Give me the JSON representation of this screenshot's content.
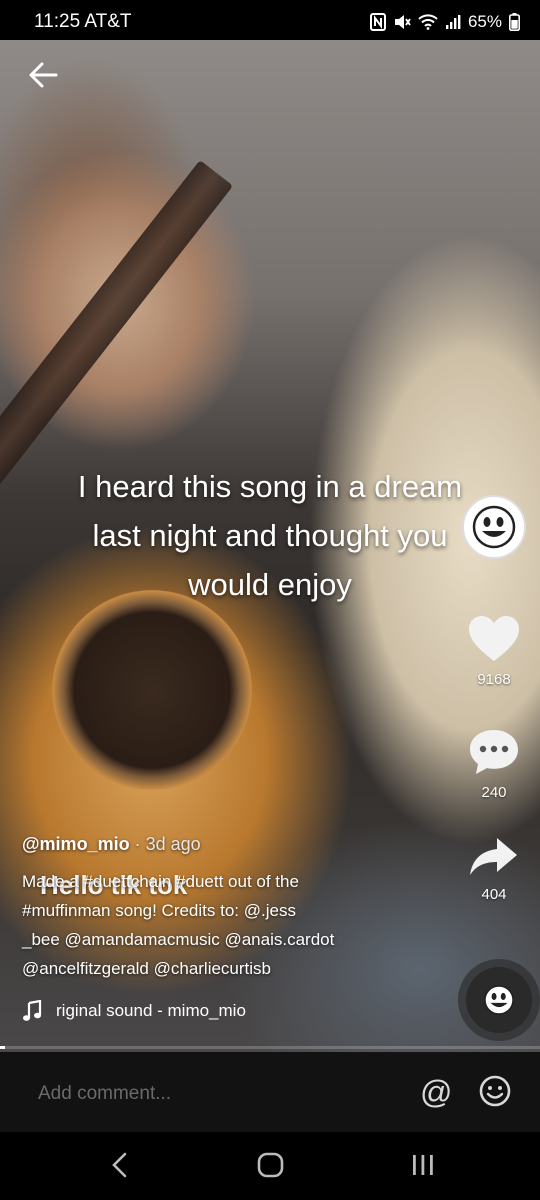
{
  "status_bar": {
    "time_carrier": "11:25 AT&T",
    "battery": "65%",
    "icons": [
      "nfc-icon",
      "mute-icon",
      "wifi-icon",
      "signal-icon",
      "battery-icon"
    ]
  },
  "video": {
    "caption_lines": [
      "I heard this song in a dream",
      "last night and thought you",
      "would enjoy"
    ],
    "overlay_text": "Hello tik tok",
    "progress_fraction": 0.01
  },
  "actions": {
    "likes": "9168",
    "comments": "240",
    "shares": "404"
  },
  "post": {
    "username": "@mimo_mio",
    "ago": " · 3d ago",
    "description_lines": [
      "Made a #duettchain #duett out of the",
      "#muffinman song! Credits to: @.jess",
      "_bee @amandamacmusic @anais.cardot",
      "@ancelfitzgerald @charliecurtisb"
    ],
    "sound": "riginal sound - mimo_mio"
  },
  "comment_bar": {
    "placeholder": "Add comment...",
    "at_symbol": "@"
  },
  "colors": {
    "background": "#000000",
    "comment_bar": "#121212",
    "placeholder": "#6a6a6a"
  }
}
